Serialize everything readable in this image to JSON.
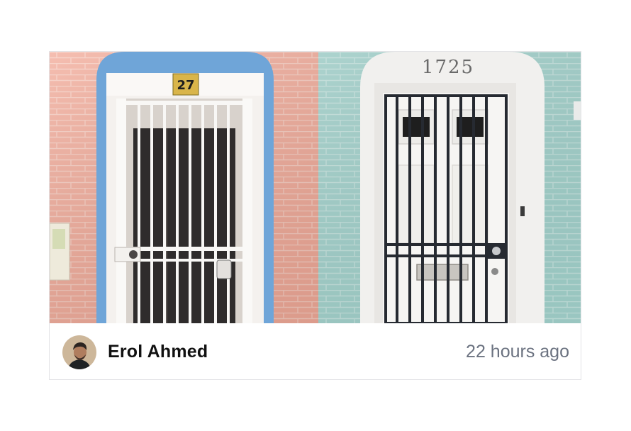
{
  "card": {
    "photo": {
      "left_house_number": "27",
      "right_house_number": "1725"
    },
    "author": {
      "name": "Erol Ahmed",
      "avatar": "author-avatar"
    },
    "timestamp": "22 hours ago"
  }
}
